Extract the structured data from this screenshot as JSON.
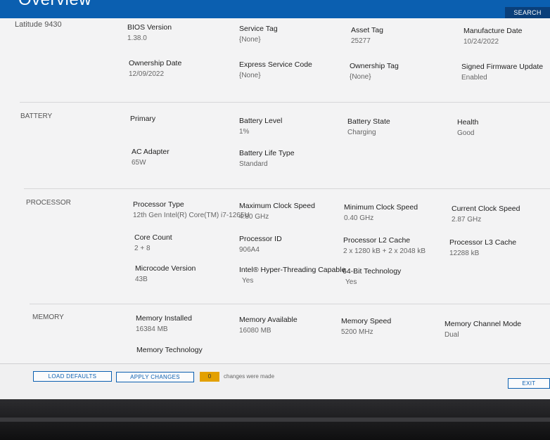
{
  "header": {
    "title": "Overview",
    "search_label": "SEARCH"
  },
  "model": "Latitude 9430",
  "overview": {
    "bios_version": {
      "label": "BIOS Version",
      "value": "1.38.0"
    },
    "service_tag": {
      "label": "Service Tag",
      "value": "{None}"
    },
    "asset_tag": {
      "label": "Asset Tag",
      "value": "25277"
    },
    "manufacture_date": {
      "label": "Manufacture Date",
      "value": "10/24/2022"
    },
    "ownership_date": {
      "label": "Ownership Date",
      "value": "12/09/2022"
    },
    "express_service_code": {
      "label": "Express Service Code",
      "value": "{None}"
    },
    "ownership_tag": {
      "label": "Ownership Tag",
      "value": "{None}"
    },
    "signed_firmware_update": {
      "label": "Signed Firmware Update",
      "value": "Enabled"
    }
  },
  "battery": {
    "section": "BATTERY",
    "primary": {
      "label": "Primary"
    },
    "level": {
      "label": "Battery Level",
      "value": "1%"
    },
    "state": {
      "label": "Battery State",
      "value": "Charging"
    },
    "health": {
      "label": "Health",
      "value": "Good"
    },
    "ac_adapter": {
      "label": "AC Adapter",
      "value": "65W"
    },
    "life_type": {
      "label": "Battery Life Type",
      "value": "Standard"
    }
  },
  "processor": {
    "section": "PROCESSOR",
    "type": {
      "label": "Processor Type",
      "value": "12th Gen Intel(R) Core(TM) i7-1265U"
    },
    "max_clock": {
      "label": "Maximum Clock Speed",
      "value": "4.80 GHz"
    },
    "min_clock": {
      "label": "Minimum Clock Speed",
      "value": "0.40 GHz"
    },
    "current_clock": {
      "label": "Current Clock Speed",
      "value": "2.87 GHz"
    },
    "core_count": {
      "label": "Core Count",
      "value": "2 + 8"
    },
    "processor_id": {
      "label": "Processor ID",
      "value": "906A4"
    },
    "l2_cache": {
      "label": "Processor L2 Cache",
      "value": "2 x 1280  kB + 2 x 2048  kB"
    },
    "l3_cache": {
      "label": "Processor L3 Cache",
      "value": "12288 kB"
    },
    "microcode": {
      "label": "Microcode Version",
      "value": "43B"
    },
    "hyperthreading": {
      "label": "Intel® Hyper-Threading Capable",
      "value": "Yes"
    },
    "bit64": {
      "label": "64-Bit Technology",
      "value": "Yes"
    }
  },
  "memory": {
    "section": "MEMORY",
    "installed": {
      "label": "Memory Installed",
      "value": "16384 MB"
    },
    "available": {
      "label": "Memory Available",
      "value": "16080 MB"
    },
    "speed": {
      "label": "Memory Speed",
      "value": "5200 MHz"
    },
    "channel_mode": {
      "label": "Memory Channel Mode",
      "value": "Dual"
    },
    "technology": {
      "label": "Memory Technology"
    }
  },
  "footer": {
    "load_defaults": "LOAD DEFAULTS",
    "apply_changes": "APPLY CHANGES",
    "changes_count": "0",
    "changes_text": "changes were made",
    "exit": "EXIT"
  },
  "colors": {
    "accent": "#0b5fb0",
    "badge": "#e3a000"
  }
}
